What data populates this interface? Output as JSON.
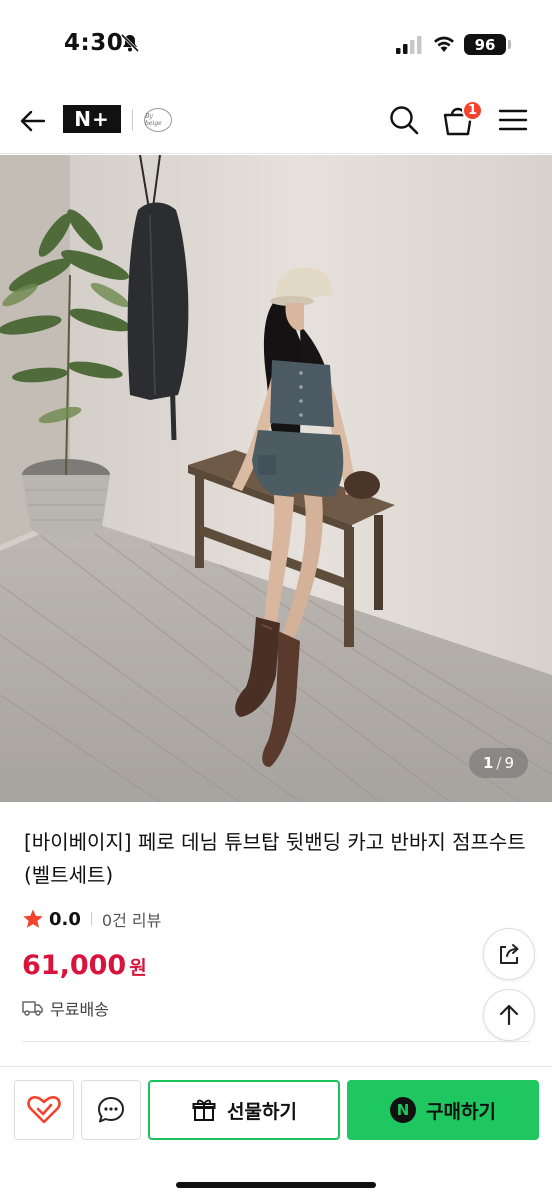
{
  "status_bar": {
    "time": "4:30",
    "battery": "96"
  },
  "nav": {
    "logo_text": "N+",
    "brand_seal_text": "By beige",
    "cart_count": "1"
  },
  "gallery": {
    "current": "1",
    "separator": "/",
    "total": "9"
  },
  "product": {
    "title": "[바이베이지] 페로 데님 튜브탑 뒷밴딩 카고 반바지 점프수트 (벨트세트)",
    "rating": "0.0",
    "review_count": "0건 리뷰",
    "price": "61,000",
    "price_unit": "원",
    "shipping": "무료배송"
  },
  "actions": {
    "gift_label": "선물하기",
    "buy_label": "구매하기",
    "npay_mark": "N"
  },
  "colors": {
    "price": "#d8143c",
    "npay_green": "#1ec75f",
    "badge": "#f4422c"
  }
}
